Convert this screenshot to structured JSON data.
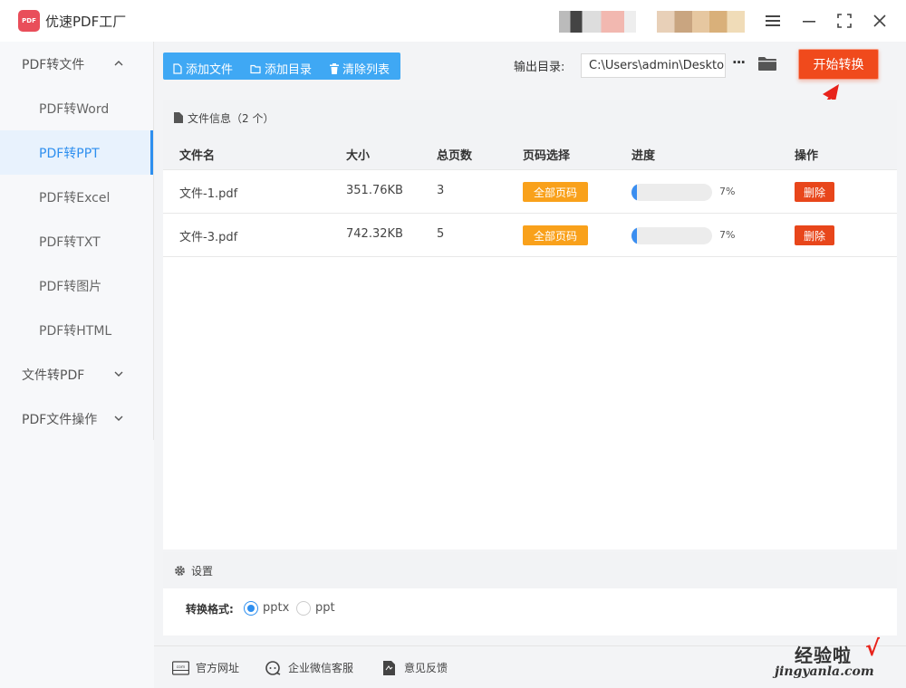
{
  "app": {
    "title": "优速PDF工厂",
    "logo_text": "PDF"
  },
  "window": {
    "menu_icon": "menu-icon",
    "minimize_icon": "minimize-icon",
    "maximize_icon": "maximize-icon",
    "close_icon": "close-icon"
  },
  "sidebar": {
    "groups": [
      {
        "label": "PDF转文件",
        "expanded": true
      },
      {
        "label": "文件转PDF",
        "expanded": false
      },
      {
        "label": "PDF文件操作",
        "expanded": false
      }
    ],
    "items": [
      {
        "label": "PDF转Word",
        "active": false
      },
      {
        "label": "PDF转PPT",
        "active": true
      },
      {
        "label": "PDF转Excel",
        "active": false
      },
      {
        "label": "PDF转TXT",
        "active": false
      },
      {
        "label": "PDF转图片",
        "active": false
      },
      {
        "label": "PDF转HTML",
        "active": false
      }
    ]
  },
  "toolbar": {
    "add_file": "添加文件",
    "add_dir": "添加目录",
    "clear_list": "清除列表",
    "output_label": "输出目录:",
    "output_path": "C:\\Users\\admin\\Deskto",
    "more_label": "···",
    "start_label": "开始转换"
  },
  "files": {
    "header": "文件信息（2 个）",
    "columns": [
      "文件名",
      "大小",
      "总页数",
      "页码选择",
      "进度",
      "操作"
    ],
    "rows": [
      {
        "name": "文件-1.pdf",
        "size": "351.76KB",
        "pages": "3",
        "page_select": "全部页码",
        "progress": 0.07,
        "progress_text": "7%",
        "action": "删除"
      },
      {
        "name": "文件-3.pdf",
        "size": "742.32KB",
        "pages": "5",
        "page_select": "全部页码",
        "progress": 0.07,
        "progress_text": "7%",
        "action": "删除"
      }
    ]
  },
  "settings": {
    "header": "设置",
    "format_label": "转换格式:",
    "options": [
      {
        "label": "pptx",
        "selected": true
      },
      {
        "label": "ppt",
        "selected": false
      }
    ]
  },
  "footer": {
    "website": "官方网址",
    "wechat": "企业微信客服",
    "feedback": "意见反馈"
  },
  "watermark": {
    "cn": "经验啦",
    "check": "√",
    "url": "jingyanla.com"
  },
  "colors": {
    "accent": "#2e8fef",
    "toolbar": "#3fa8f4",
    "start": "#f04a1c",
    "badge": "#f9a11b",
    "delete": "#e8461b"
  }
}
